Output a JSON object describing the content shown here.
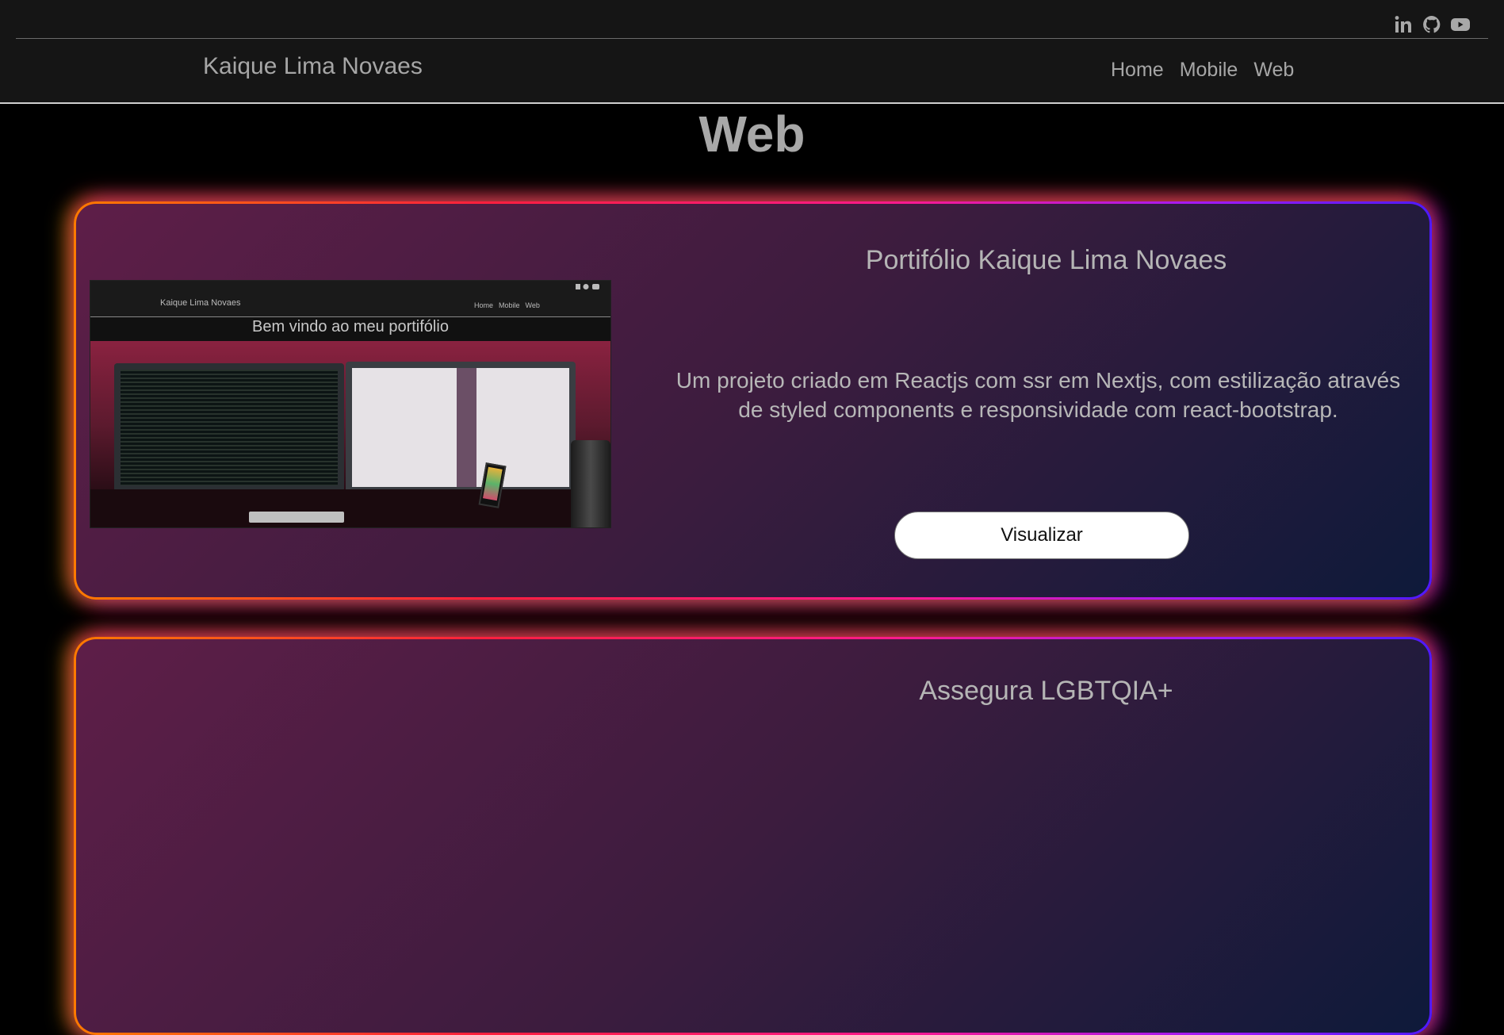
{
  "social": {
    "icons": [
      "linkedin-icon",
      "github-icon",
      "youtube-icon"
    ]
  },
  "navbar": {
    "brand": "Kaique Lima Novaes",
    "links": [
      "Home",
      "Mobile",
      "Web"
    ]
  },
  "page": {
    "title": "Web"
  },
  "projects": [
    {
      "title": "Portifólio Kaique Lima Novaes",
      "description": "Um projeto criado em Reactjs com ssr em Nextjs, com estilização através de styled components e responsividade com react-bootstrap.",
      "button_label": "Visualizar",
      "thumbnail": {
        "brand": "Kaique Lima Novaes",
        "links": [
          "Home",
          "Mobile",
          "Web"
        ],
        "welcome": "Bem vindo ao meu portifólio"
      }
    },
    {
      "title": "Assegura LGBTQIA+"
    }
  ],
  "colors": {
    "background": "#000000",
    "bar": "#151515",
    "text": "#a8a8a8",
    "border_gradient": [
      "#ff7a00",
      "#ff1f3d",
      "#ff1a8a",
      "#9a1aff",
      "#4f1aff"
    ],
    "card_gradient": [
      "#5e1e48",
      "#3c1c3e",
      "#0e1a3a"
    ]
  }
}
